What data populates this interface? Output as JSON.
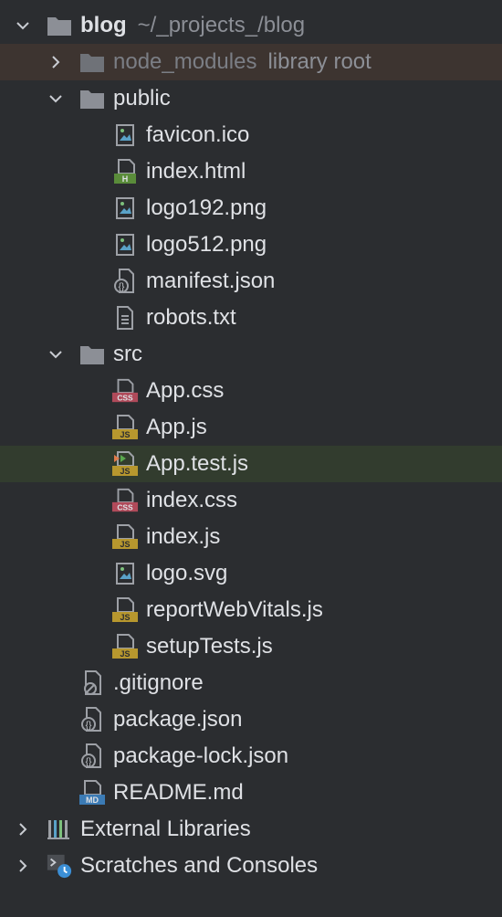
{
  "project": {
    "name": "blog",
    "path": "~/_projects_/blog",
    "items": {
      "node_modules": {
        "label": "node_modules",
        "hint": "library root"
      },
      "public": {
        "label": "public"
      },
      "favicon": {
        "label": "favicon.ico"
      },
      "index_html": {
        "label": "index.html"
      },
      "logo192": {
        "label": "logo192.png"
      },
      "logo512": {
        "label": "logo512.png"
      },
      "manifest": {
        "label": "manifest.json"
      },
      "robots": {
        "label": "robots.txt"
      },
      "src": {
        "label": "src"
      },
      "app_css": {
        "label": "App.css"
      },
      "app_js": {
        "label": "App.js"
      },
      "app_test": {
        "label": "App.test.js"
      },
      "index_css": {
        "label": "index.css"
      },
      "index_js": {
        "label": "index.js"
      },
      "logo_svg": {
        "label": "logo.svg"
      },
      "report": {
        "label": "reportWebVitals.js"
      },
      "setup": {
        "label": "setupTests.js"
      },
      "gitignore": {
        "label": ".gitignore"
      },
      "package": {
        "label": "package.json"
      },
      "package_lock": {
        "label": "package-lock.json"
      },
      "readme": {
        "label": "README.md"
      }
    }
  },
  "external_libraries": {
    "label": "External Libraries"
  },
  "scratches": {
    "label": "Scratches and Consoles"
  },
  "icons": {
    "css_badge": "CSS",
    "js_badge": "JS",
    "html_badge": "H",
    "md_badge": "MD"
  },
  "colors": {
    "background": "#2b2d30",
    "excluded_row": "#3d3430",
    "selected_row": "#323c2e",
    "folder": "#8c8f96",
    "js_badge": "#b7972e",
    "css_badge": "#b04a5a",
    "html_badge": "#5a8c3a",
    "md_badge": "#3b7bb5"
  }
}
